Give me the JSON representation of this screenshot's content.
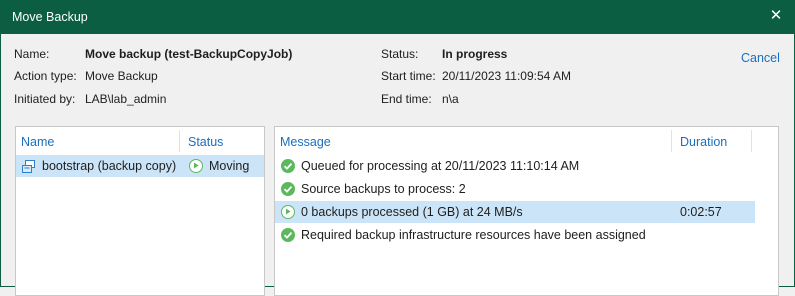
{
  "window": {
    "title": "Move Backup"
  },
  "info": {
    "name_label": "Name:",
    "name_value": "Move backup (test-BackupCopyJob)",
    "action_label": "Action type:",
    "action_value": "Move Backup",
    "initiated_label": "Initiated by:",
    "initiated_value": "LAB\\lab_admin",
    "status_label": "Status:",
    "status_value": "In progress",
    "start_label": "Start time:",
    "start_value": "20/11/2023 11:09:54 AM",
    "end_label": "End time:",
    "end_value": "n\\a"
  },
  "cancel_label": "Cancel",
  "objects": {
    "headers": {
      "name": "Name",
      "status": "Status"
    },
    "rows": [
      {
        "name": "bootstrap (backup copy)",
        "status": "Moving",
        "icon": "backup-copy-icon",
        "status_icon": "play-circle-icon"
      }
    ]
  },
  "log": {
    "headers": {
      "message": "Message",
      "duration": "Duration"
    },
    "rows": [
      {
        "message": "Queued for processing at 20/11/2023 11:10:14 AM",
        "duration": "",
        "icon": "check-circle-icon"
      },
      {
        "message": "Source backups to process: 2",
        "duration": "",
        "icon": "check-circle-icon"
      },
      {
        "message": "0 backups processed (1 GB) at 24 MB/s",
        "duration": "0:02:57",
        "icon": "play-circle-icon"
      },
      {
        "message": "Required backup infrastructure resources have been assigned",
        "duration": "",
        "icon": "check-circle-icon"
      }
    ]
  },
  "colors": {
    "titlebar": "#0b5e42",
    "accent": "#1a6fbf",
    "selection": "#cce4f7",
    "success": "#5cb85c"
  }
}
